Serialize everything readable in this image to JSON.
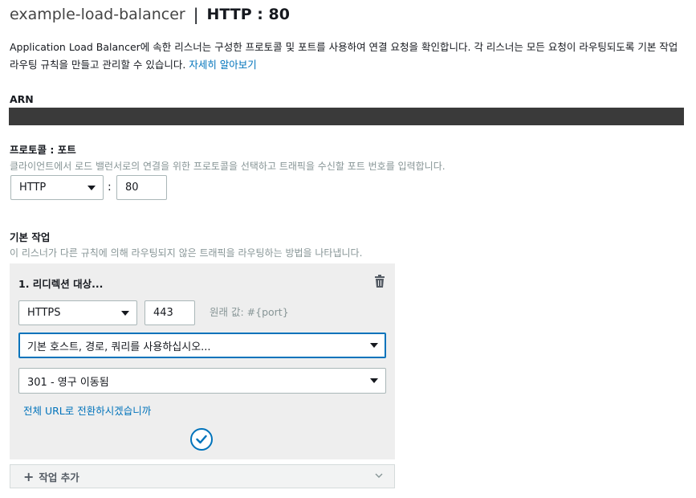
{
  "header": {
    "name": "example-load-balancer",
    "separator": "|",
    "protocol_port": "HTTP : 80"
  },
  "description": {
    "line1": "Application Load Balancer에 속한 리스너는 구성한 프로토콜 및 포트를 사용하여 연결 요청을 확인합니다. 각 리스너는 모든 요청이 라우팅되도록 기본 작업",
    "line2": "라우팅 규칙을 만들고 관리할 수 있습니다.",
    "learn_more": "자세히 알아보기"
  },
  "arn": {
    "label": "ARN"
  },
  "protocol_port": {
    "label": "프로토콜 : 포트",
    "hint": "클라이언트에서 로드 밸런서로의 연결을 위한 프로토콜을 선택하고 트래픽을 수신할 포트 번호를 입력합니다.",
    "protocol_value": "HTTP",
    "colon": ":",
    "port_value": "80"
  },
  "default_action": {
    "label": "기본 작업",
    "hint": "이 리스너가 다른 규칙에 의해 라우팅되지 않은 트래픽을 라우팅하는 방법을 나타냅니다.",
    "action_title": "1. 리디렉션 대상...",
    "redirect_protocol": "HTTPS",
    "redirect_port": "443",
    "original_value_hint": "원래 값: #{port}",
    "host_path_query": "기본 호스트, 경로, 쿼리를 사용하십시오...",
    "status_code": "301 - 영구 이동됨",
    "full_url_link": "전체 URL로 전환하시겠습니까"
  },
  "add_action": {
    "label": "작업 추가"
  },
  "icons": {
    "trash": "trash-icon",
    "check": "check-circle-icon",
    "plus": "plus-icon",
    "chevron": "chevron-down-icon"
  },
  "colors": {
    "accent": "#0073bb",
    "arn_bar": "#3a3a3a",
    "panel": "#eeeeee"
  }
}
